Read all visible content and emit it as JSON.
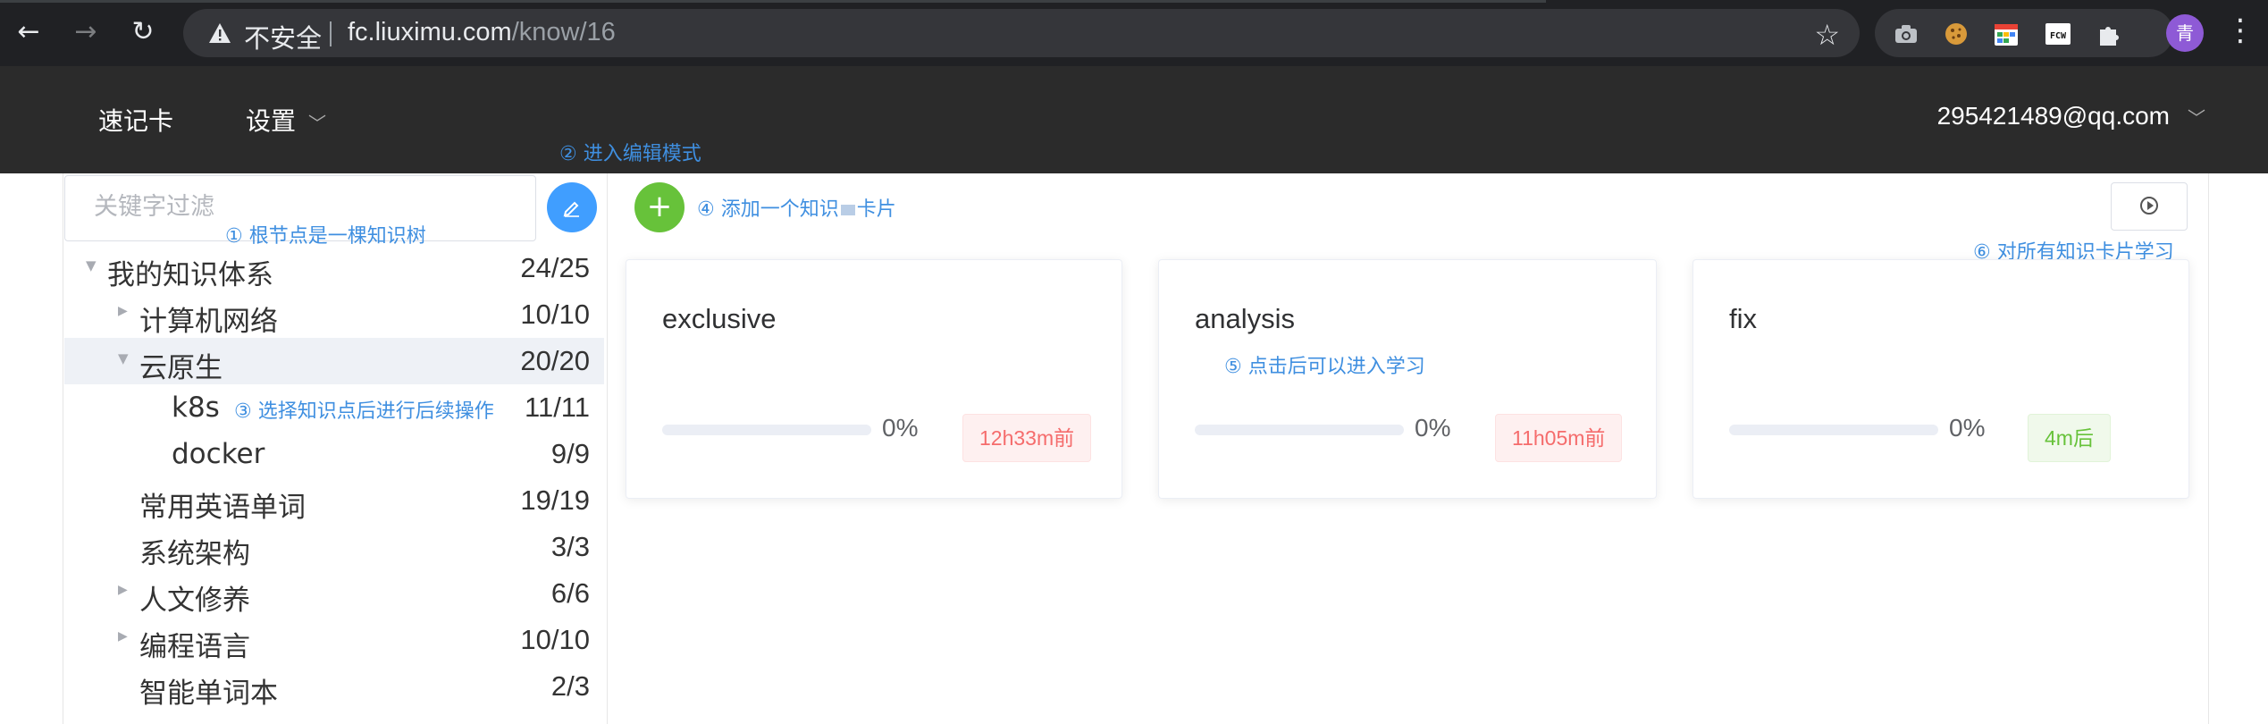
{
  "browser": {
    "insecure_label": "不安全",
    "url_host": "fc.liuximu.com",
    "url_path": "/know/16",
    "avatar_letter": "青"
  },
  "header": {
    "brand": "速记卡",
    "settings": "设置",
    "user": "295421489@qq.com"
  },
  "annotations": {
    "a1": "① 根节点是一棵知识树",
    "a2": "② 进入编辑模式",
    "a3": "③ 选择知识点后进行后续操作",
    "a4": "④ 添加一个知识",
    "a4b": "卡片",
    "a5": "⑤ 点击后可以进入学习",
    "a6": "⑥ 对所有知识卡片学习"
  },
  "filter": {
    "placeholder": "关键字过滤"
  },
  "tree": [
    {
      "label": "我的知识体系",
      "count": "24/25",
      "level": 0,
      "caret": "down"
    },
    {
      "label": "计算机网络",
      "count": "10/10",
      "level": 1,
      "caret": "right"
    },
    {
      "label": "云原生",
      "count": "20/20",
      "level": 1,
      "caret": "down",
      "active": true
    },
    {
      "label": "k8s",
      "count": "11/11",
      "level": 2,
      "caret": ""
    },
    {
      "label": "docker",
      "count": "9/9",
      "level": 2,
      "caret": ""
    },
    {
      "label": "常用英语单词",
      "count": "19/19",
      "level": 1,
      "caret": ""
    },
    {
      "label": "系统架构",
      "count": "3/3",
      "level": 1,
      "caret": ""
    },
    {
      "label": "人文修养",
      "count": "6/6",
      "level": 1,
      "caret": "right"
    },
    {
      "label": "编程语言",
      "count": "10/10",
      "level": 1,
      "caret": "right"
    },
    {
      "label": "智能单词本",
      "count": "2/3",
      "level": 1,
      "caret": ""
    }
  ],
  "cards": [
    {
      "title": "exclusive",
      "progress": 0,
      "pct": "0%",
      "time": "12h33m前",
      "status": "danger"
    },
    {
      "title": "analysis",
      "progress": 0,
      "pct": "0%",
      "time": "11h05m前",
      "status": "danger"
    },
    {
      "title": "fix",
      "progress": 0,
      "pct": "0%",
      "time": "4m后",
      "status": "success"
    }
  ]
}
